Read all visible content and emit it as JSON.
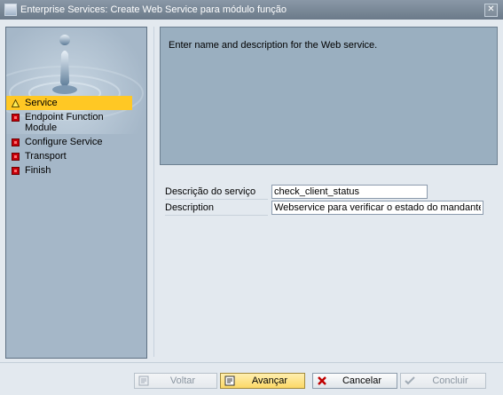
{
  "window": {
    "title": "Enterprise Services: Create Web Service para módulo função",
    "close_glyph": "✕"
  },
  "steps": [
    {
      "label": "Service",
      "icon": "warning-icon",
      "active": true
    },
    {
      "label": "Endpoint Function Module",
      "icon": "error-icon",
      "active": false
    },
    {
      "label": "Configure Service",
      "icon": "error-icon",
      "active": false
    },
    {
      "label": "Transport",
      "icon": "error-icon",
      "active": false
    },
    {
      "label": "Finish",
      "icon": "error-icon",
      "active": false
    }
  ],
  "instruction": "Enter name and description for the Web service.",
  "form": {
    "service_desc_label": "Descrição do serviço",
    "service_desc_value": "check_client_status",
    "description_label": "Description",
    "description_value": "Webservice para verificar o estado do mandante"
  },
  "buttons": {
    "back": "Voltar",
    "next": "Avançar",
    "cancel": "Cancelar",
    "finish": "Concluir"
  },
  "colors": {
    "active_step": "#ffc824",
    "error_icon": "#c6000b",
    "panel_bg": "#9aafc0"
  }
}
